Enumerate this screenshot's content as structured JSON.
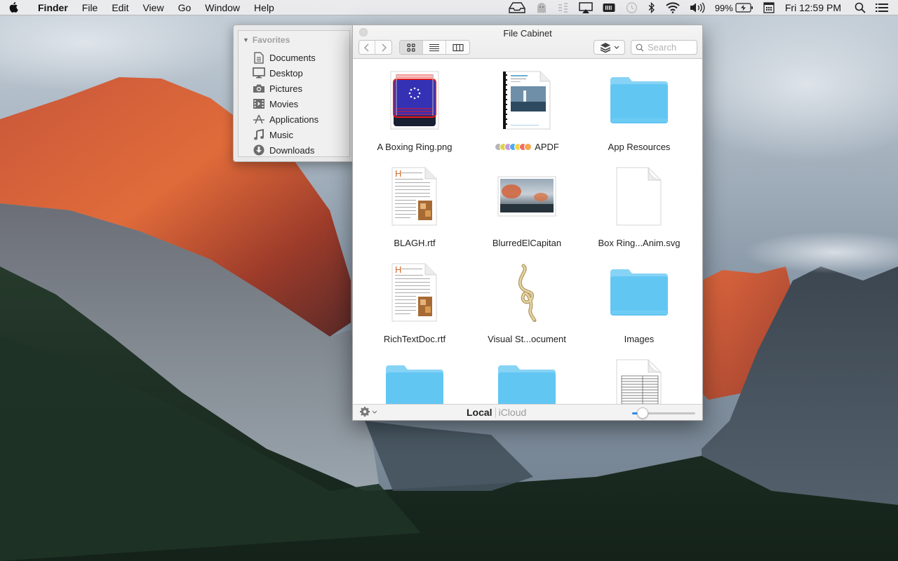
{
  "menubar": {
    "apple_icon": "apple-icon",
    "app_name": "Finder",
    "menus": [
      "File",
      "Edit",
      "View",
      "Go",
      "Window",
      "Help"
    ],
    "status_icons": [
      "inbox-tray-icon",
      "ghost-icon",
      "equalizer-icon",
      "airplay-icon",
      "battery-meter-icon",
      "time-machine-icon",
      "bluetooth-icon",
      "wifi-icon",
      "volume-icon"
    ],
    "battery_percent": "99%",
    "battery_icon": "battery-charging-icon",
    "calendar_icon": "calendar-icon",
    "clock": "Fri 12:59 PM",
    "spotlight_icon": "search-icon",
    "notification_icon": "list-icon"
  },
  "sidebar": {
    "section_title": "Favorites",
    "items": [
      {
        "label": "Documents",
        "icon": "document-icon"
      },
      {
        "label": "Desktop",
        "icon": "desktop-icon"
      },
      {
        "label": "Pictures",
        "icon": "camera-icon"
      },
      {
        "label": "Movies",
        "icon": "film-icon"
      },
      {
        "label": "Applications",
        "icon": "applications-icon"
      },
      {
        "label": "Music",
        "icon": "music-note-icon"
      },
      {
        "label": "Downloads",
        "icon": "download-icon"
      }
    ]
  },
  "window": {
    "title": "File Cabinet",
    "toolbar": {
      "back_icon": "chevron-left-icon",
      "forward_icon": "chevron-right-icon",
      "view_modes": [
        "icon-view",
        "list-view",
        "column-view"
      ],
      "active_view": "icon-view",
      "arrange_icon": "layers-icon",
      "search_placeholder": "Search",
      "search_value": ""
    },
    "files": [
      {
        "name": "A Boxing Ring.png",
        "kind": "boxing-ring-image"
      },
      {
        "name": "APDF",
        "kind": "pdf-document",
        "tags": [
          "#b5b5b5",
          "#e0d34a",
          "#c69be0",
          "#4ea8f0",
          "#f5d64a",
          "#f46a60",
          "#f7a84a"
        ]
      },
      {
        "name": "App Resources",
        "kind": "folder"
      },
      {
        "name": "BLAGH.rtf",
        "kind": "rtf-document"
      },
      {
        "name": "BlurredElCapitan",
        "kind": "landscape-image"
      },
      {
        "name": "Box Ring...Anim.svg",
        "kind": "blank-document"
      },
      {
        "name": "RichTextDoc.rtf",
        "kind": "rtf-document"
      },
      {
        "name": "Visual St...ocument",
        "kind": "rope-document"
      },
      {
        "name": "Images",
        "kind": "folder"
      },
      {
        "name": "",
        "kind": "folder"
      },
      {
        "name": "",
        "kind": "folder"
      },
      {
        "name": "",
        "kind": "table-document"
      }
    ],
    "bottombar": {
      "gear_icon": "gear-icon",
      "location_local": "Local",
      "location_icloud": "iCloud",
      "active_location": "Local",
      "icon_size_slider": 0.1
    }
  },
  "colors": {
    "folder_blue": "#5ec8f2",
    "accent": "#2d8cf0"
  }
}
